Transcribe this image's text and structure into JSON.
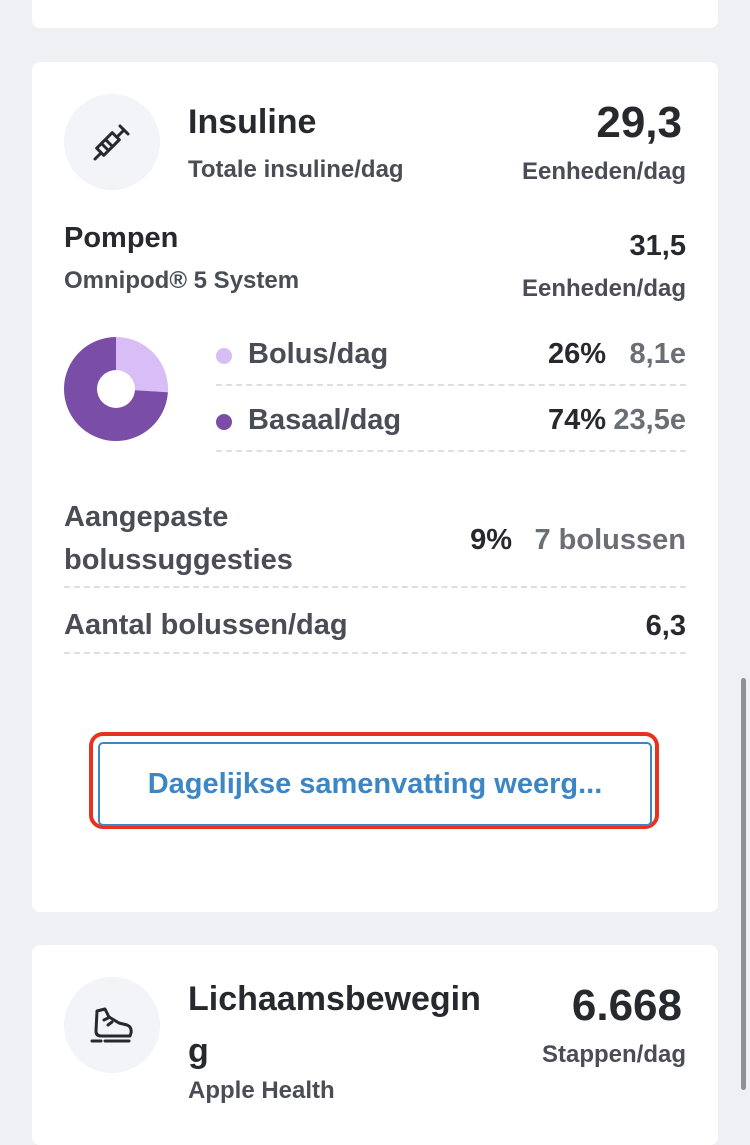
{
  "insulin": {
    "title": "Insuline",
    "subtitle": "Totale insuline/dag",
    "value": "29,3",
    "unit": "Eenheden/dag",
    "pump": {
      "title": "Pompen",
      "system": "Omnipod® 5 System",
      "value": "31,5",
      "unit": "Eenheden/dag"
    },
    "breakdown": [
      {
        "label": "Bolus/dag",
        "percent": "26%",
        "amount": "8,1e",
        "color": "#d9bdf7",
        "fraction": 0.26
      },
      {
        "label": "Basaal/dag",
        "percent": "74%",
        "amount": "23,5e",
        "color": "#7a4ea6",
        "fraction": 0.74
      }
    ],
    "stats": {
      "adjusted_label_line1": "Aangepaste",
      "adjusted_label_line2": "bolussuggesties",
      "adjusted_percent": "9%",
      "adjusted_value": "7 bolussen",
      "bolus_count_label": "Aantal bolussen/dag",
      "bolus_count_value": "6,3"
    },
    "summary_button": "Dagelijkse samenvatting weerg..."
  },
  "activity": {
    "title_line1": "Lichaamsbewegin",
    "title_line2": "g",
    "subtitle": "Apple Health",
    "value": "6.668",
    "unit": "Stappen/dag"
  },
  "icons": {
    "insulin": "syringe-icon",
    "activity": "shoe-icon"
  }
}
